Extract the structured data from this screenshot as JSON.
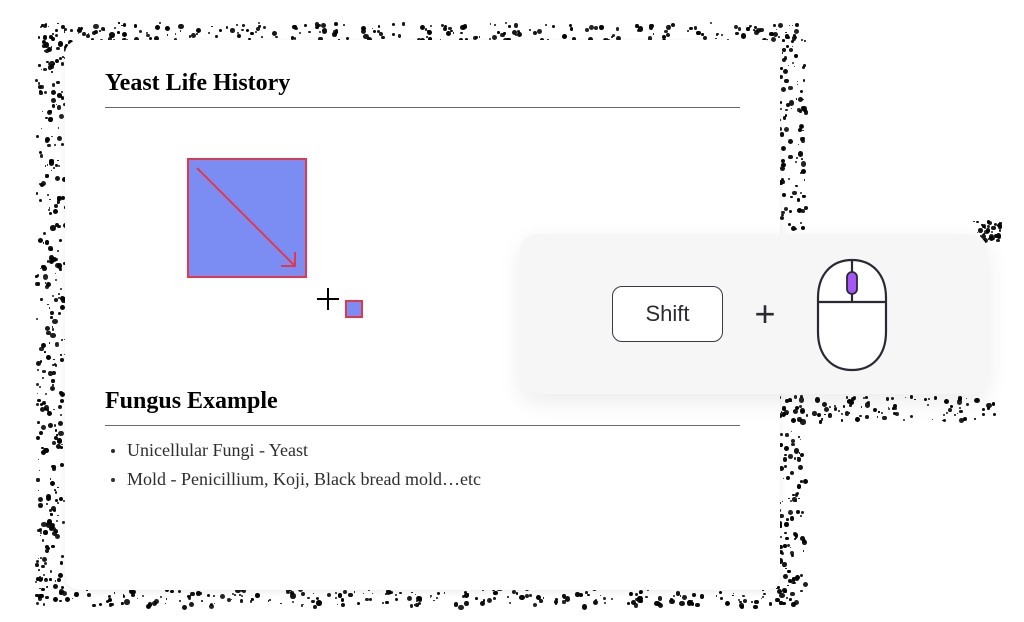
{
  "document": {
    "heading1": "Yeast Life History",
    "heading2": "Fungus Example",
    "bullets": [
      "Unicellular Fungi - Yeast",
      "Mold - Penicillium, Koji, Black bread mold…etc"
    ]
  },
  "shape": {
    "fill": "#7b8df2",
    "stroke": "#e5374b",
    "arrow_color": "#e5374b"
  },
  "hint": {
    "key_label": "Shift",
    "plus": "+",
    "mouse_scroll_color": "#a855f7"
  }
}
